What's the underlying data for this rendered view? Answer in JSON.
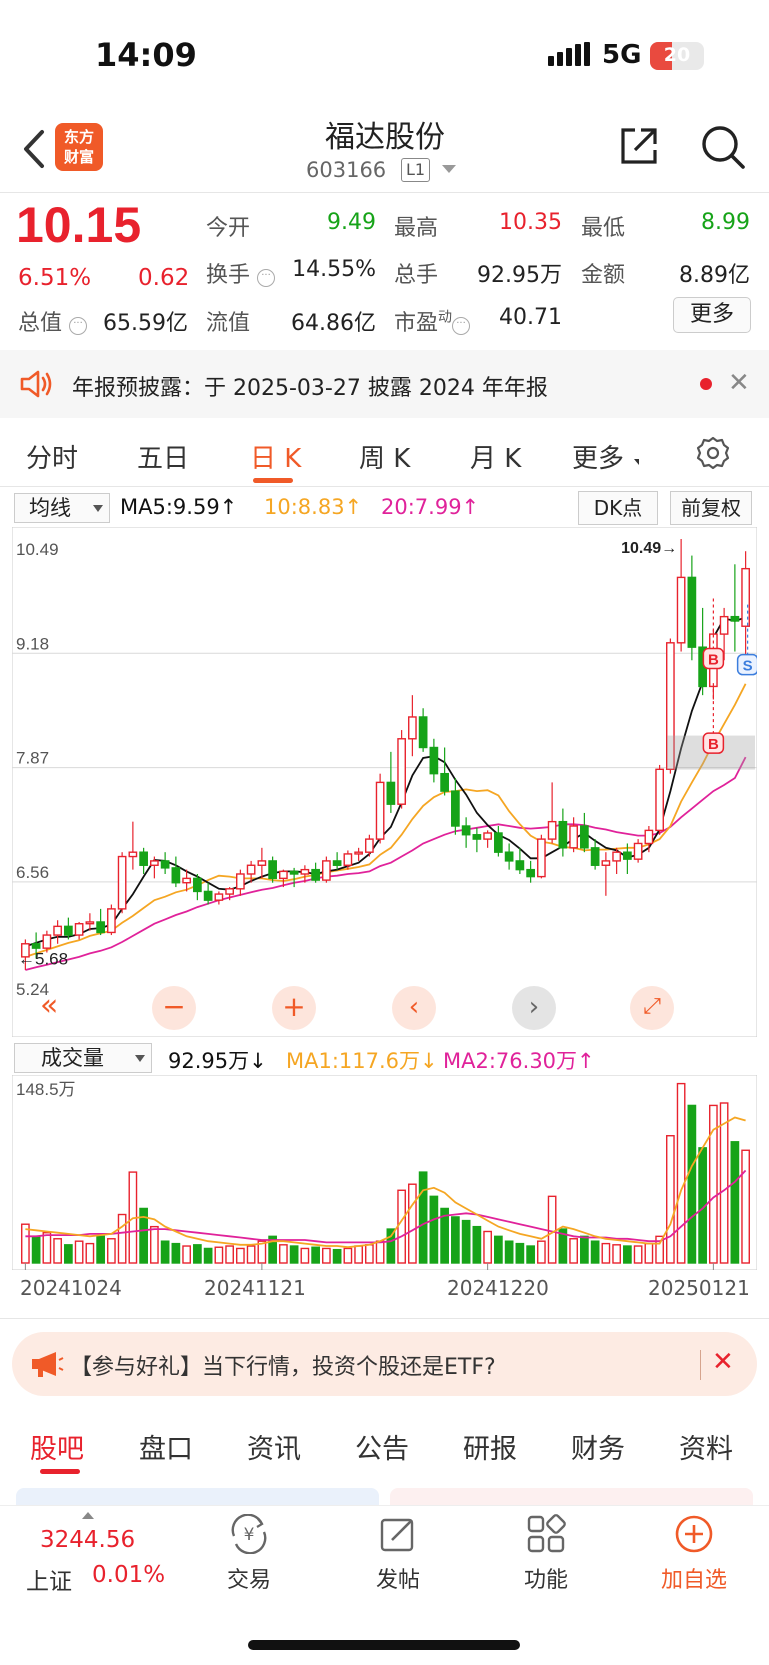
{
  "status": {
    "time": "14:09",
    "network": "5G",
    "battery": "20"
  },
  "header": {
    "name": "福达股份",
    "code": "603166",
    "level": "L1",
    "logo_line1": "东方",
    "logo_line2": "财富"
  },
  "quote": {
    "price": "10.15",
    "change_pct": "6.51%",
    "change": "0.62",
    "rows": {
      "open_label": "今开",
      "open": "9.49",
      "high_label": "最高",
      "high": "10.35",
      "low_label": "最低",
      "low": "8.99",
      "turnover_label": "换手",
      "turnover": "14.55%",
      "volume_label": "总手",
      "volume": "92.95万",
      "amount_label": "金额",
      "amount": "8.89亿",
      "mktcap_label": "总值",
      "mktcap": "65.59亿",
      "float_label": "流值",
      "float": "64.86亿",
      "pe_label": "市盈",
      "pe_sup": "动",
      "pe": "40.71"
    },
    "more": "更多"
  },
  "notice": {
    "text": "年报预披露：于 2025-03-27 披露 2024 年年报"
  },
  "chart_tabs": [
    "分时",
    "五日",
    "日 K",
    "周 K",
    "月 K",
    "更多"
  ],
  "indicators": {
    "ma_select": "均线",
    "ma5": "MA5:9.59↑",
    "ma10": "10:8.83↑",
    "ma20": "20:7.99↑",
    "dk": "DK点",
    "adjust": "前复权"
  },
  "colors": {
    "up": "#e8222d",
    "down": "#16a318",
    "ma5": "#111111",
    "ma10": "#f5a623",
    "ma20": "#e0229a",
    "accent": "#f05a28"
  },
  "chart_data": [
    {
      "type": "candlestick",
      "y_ticks": [
        "10.49",
        "9.18",
        "7.87",
        "6.56",
        "5.24"
      ],
      "ylim": [
        5.24,
        10.49
      ],
      "high_marker": "10.49→",
      "low_marker": "←5.68",
      "signals": [
        "B",
        "S",
        "B"
      ],
      "ohlc": [
        [
          5.7,
          5.9,
          5.55,
          5.85
        ],
        [
          5.85,
          5.98,
          5.68,
          5.8
        ],
        [
          5.8,
          6.0,
          5.75,
          5.95
        ],
        [
          5.95,
          6.12,
          5.85,
          6.05
        ],
        [
          6.05,
          6.15,
          5.9,
          5.95
        ],
        [
          5.95,
          6.1,
          5.9,
          6.08
        ],
        [
          6.08,
          6.2,
          6.0,
          6.1
        ],
        [
          6.1,
          6.25,
          5.95,
          5.98
        ],
        [
          5.98,
          6.3,
          5.95,
          6.25
        ],
        [
          6.25,
          6.9,
          6.2,
          6.85
        ],
        [
          6.85,
          7.25,
          6.7,
          6.9
        ],
        [
          6.9,
          6.95,
          6.65,
          6.75
        ],
        [
          6.75,
          6.85,
          6.6,
          6.8
        ],
        [
          6.8,
          6.9,
          6.65,
          6.72
        ],
        [
          6.72,
          6.85,
          6.5,
          6.55
        ],
        [
          6.55,
          6.7,
          6.45,
          6.6
        ],
        [
          6.6,
          6.65,
          6.35,
          6.45
        ],
        [
          6.45,
          6.55,
          6.3,
          6.35
        ],
        [
          6.35,
          6.45,
          6.3,
          6.42
        ],
        [
          6.42,
          6.5,
          6.35,
          6.48
        ],
        [
          6.48,
          6.7,
          6.4,
          6.65
        ],
        [
          6.65,
          6.8,
          6.55,
          6.75
        ],
        [
          6.75,
          6.95,
          6.6,
          6.8
        ],
        [
          6.8,
          6.85,
          6.55,
          6.6
        ],
        [
          6.6,
          6.7,
          6.5,
          6.68
        ],
        [
          6.68,
          6.72,
          6.5,
          6.65
        ],
        [
          6.65,
          6.75,
          6.55,
          6.7
        ],
        [
          6.7,
          6.78,
          6.55,
          6.58
        ],
        [
          6.58,
          6.85,
          6.55,
          6.8
        ],
        [
          6.8,
          6.9,
          6.7,
          6.75
        ],
        [
          6.75,
          6.92,
          6.7,
          6.88
        ],
        [
          6.88,
          6.95,
          6.8,
          6.9
        ],
        [
          6.9,
          7.1,
          6.85,
          7.05
        ],
        [
          7.05,
          7.8,
          7.0,
          7.7
        ],
        [
          7.7,
          8.05,
          7.35,
          7.45
        ],
        [
          7.45,
          8.3,
          7.4,
          8.2
        ],
        [
          8.2,
          8.7,
          8.0,
          8.45
        ],
        [
          8.45,
          8.55,
          8.05,
          8.1
        ],
        [
          8.1,
          8.2,
          7.7,
          7.8
        ],
        [
          7.8,
          8.1,
          7.55,
          7.6
        ],
        [
          7.6,
          7.75,
          7.1,
          7.2
        ],
        [
          7.2,
          7.3,
          6.95,
          7.1
        ],
        [
          7.1,
          7.18,
          6.9,
          7.05
        ],
        [
          7.05,
          7.15,
          6.95,
          7.12
        ],
        [
          7.12,
          7.2,
          6.85,
          6.9
        ],
        [
          6.9,
          7.0,
          6.7,
          6.8
        ],
        [
          6.8,
          6.95,
          6.65,
          6.7
        ],
        [
          6.7,
          6.8,
          6.55,
          6.62
        ],
        [
          6.62,
          7.1,
          6.6,
          7.05
        ],
        [
          7.05,
          7.7,
          7.0,
          7.25
        ],
        [
          7.25,
          7.4,
          6.85,
          6.95
        ],
        [
          6.95,
          7.3,
          6.9,
          7.2
        ],
        [
          7.2,
          7.35,
          6.9,
          6.95
        ],
        [
          6.95,
          7.05,
          6.7,
          6.75
        ],
        [
          6.75,
          6.9,
          6.4,
          6.8
        ],
        [
          6.8,
          6.95,
          6.65,
          6.9
        ],
        [
          6.9,
          7.0,
          6.65,
          6.82
        ],
        [
          6.82,
          7.05,
          6.78,
          7.0
        ],
        [
          7.0,
          7.2,
          6.9,
          7.15
        ],
        [
          7.15,
          7.9,
          7.1,
          7.85
        ],
        [
          7.85,
          9.35,
          7.8,
          9.3
        ],
        [
          9.3,
          10.49,
          9.2,
          10.05
        ],
        [
          10.05,
          10.3,
          9.1,
          9.25
        ],
        [
          9.25,
          9.7,
          8.7,
          8.8
        ],
        [
          8.8,
          9.45,
          8.65,
          9.4
        ],
        [
          9.4,
          9.7,
          9.1,
          9.6
        ],
        [
          9.6,
          10.2,
          9.2,
          9.55
        ],
        [
          9.49,
          10.35,
          8.99,
          10.15
        ]
      ],
      "ma5": [
        5.82,
        5.86,
        5.9,
        5.93,
        5.93,
        5.96,
        6.02,
        6.03,
        6.07,
        6.25,
        6.42,
        6.62,
        6.81,
        6.8,
        6.75,
        6.68,
        6.62,
        6.55,
        6.48,
        6.47,
        6.51,
        6.57,
        6.62,
        6.66,
        6.68,
        6.68,
        6.67,
        6.65,
        6.68,
        6.7,
        6.74,
        6.78,
        6.88,
        7.06,
        7.19,
        7.47,
        7.78,
        7.98,
        8.0,
        7.93,
        7.73,
        7.56,
        7.35,
        7.21,
        7.1,
        7.04,
        6.94,
        6.83,
        6.83,
        6.9,
        6.97,
        7.05,
        7.12,
        7.03,
        6.95,
        6.92,
        6.84,
        6.87,
        6.95,
        7.16,
        7.6,
        8.09,
        8.52,
        8.85,
        9.36,
        9.58,
        9.55,
        9.59
      ],
      "ma10": [
        5.7,
        5.74,
        5.78,
        5.82,
        5.86,
        5.89,
        5.94,
        5.97,
        6.0,
        6.09,
        6.17,
        6.26,
        6.35,
        6.39,
        6.44,
        6.47,
        6.52,
        6.58,
        6.63,
        6.62,
        6.6,
        6.6,
        6.6,
        6.58,
        6.57,
        6.59,
        6.62,
        6.64,
        6.67,
        6.69,
        6.71,
        6.73,
        6.76,
        6.87,
        6.95,
        7.1,
        7.28,
        7.43,
        7.53,
        7.59,
        7.6,
        7.62,
        7.6,
        7.61,
        7.55,
        7.37,
        7.22,
        7.09,
        7.02,
        7.0,
        6.96,
        6.95,
        6.92,
        6.93,
        6.93,
        6.94,
        6.95,
        6.95,
        6.99,
        7.05,
        7.2,
        7.48,
        7.7,
        7.91,
        8.15,
        8.37,
        8.59,
        8.83
      ],
      "ma20": [
        5.55,
        5.58,
        5.61,
        5.64,
        5.67,
        5.7,
        5.74,
        5.77,
        5.81,
        5.87,
        5.94,
        6.01,
        6.08,
        6.13,
        6.18,
        6.22,
        6.27,
        6.31,
        6.35,
        6.38,
        6.41,
        6.44,
        6.47,
        6.49,
        6.52,
        6.55,
        6.57,
        6.6,
        6.62,
        6.63,
        6.65,
        6.66,
        6.68,
        6.74,
        6.78,
        6.85,
        6.92,
        7.0,
        7.05,
        7.1,
        7.14,
        7.16,
        7.18,
        7.2,
        7.22,
        7.2,
        7.18,
        7.17,
        7.18,
        7.19,
        7.22,
        7.22,
        7.21,
        7.18,
        7.16,
        7.13,
        7.11,
        7.09,
        7.09,
        7.12,
        7.19,
        7.3,
        7.4,
        7.5,
        7.6,
        7.67,
        7.75,
        7.99
      ]
    },
    {
      "type": "bar",
      "title": "成交量",
      "ymax_label": "148.5万",
      "ymax": 148.5,
      "values": [
        32,
        22,
        25,
        20,
        15,
        18,
        16,
        22,
        20,
        40,
        75,
        45,
        30,
        18,
        16,
        14,
        15,
        12,
        13,
        14,
        12,
        14,
        18,
        22,
        15,
        14,
        12,
        13,
        12,
        11,
        12,
        14,
        15,
        18,
        28,
        60,
        65,
        75,
        55,
        45,
        38,
        35,
        30,
        26,
        22,
        18,
        16,
        14,
        18,
        55,
        28,
        20,
        22,
        18,
        16,
        15,
        14,
        14,
        16,
        22,
        105,
        148,
        130,
        95,
        130,
        132,
        100,
        93
      ],
      "ma1": [
        28,
        27,
        26,
        25,
        24,
        23,
        22,
        23,
        24,
        30,
        37,
        38,
        36,
        30,
        26,
        22,
        20,
        18,
        17,
        16,
        15,
        15,
        16,
        18,
        18,
        17,
        16,
        15,
        14,
        14,
        13,
        14,
        15,
        18,
        22,
        35,
        48,
        60,
        62,
        58,
        50,
        45,
        40,
        35,
        30,
        27,
        24,
        22,
        20,
        25,
        30,
        28,
        25,
        22,
        20,
        19,
        18,
        17,
        16,
        16,
        32,
        60,
        80,
        95,
        110,
        115,
        120,
        117.6
      ],
      "ma2": [
        22,
        22,
        23,
        23,
        23,
        23,
        24,
        24,
        24,
        25,
        26,
        27,
        28,
        28,
        27,
        26,
        25,
        24,
        23,
        22,
        21,
        20,
        19,
        19,
        19,
        19,
        19,
        18,
        17,
        17,
        17,
        17,
        17,
        17,
        18,
        22,
        27,
        32,
        36,
        39,
        40,
        41,
        40,
        38,
        36,
        34,
        32,
        30,
        28,
        26,
        24,
        22,
        21,
        21,
        21,
        20,
        20,
        19,
        18,
        18,
        22,
        30,
        38,
        45,
        54,
        60,
        67,
        76.3
      ]
    }
  ],
  "volume_indicators": {
    "select": "成交量",
    "current": "92.95万↓",
    "ma1": "MA1:117.6万↓",
    "ma2": "MA2:76.30万↑"
  },
  "dates": [
    "20241024",
    "20241121",
    "20241220",
    "20250121"
  ],
  "promo": {
    "text": "【参与好礼】当下行情，投资个股还是ETF?"
  },
  "bottom_tabs": [
    "股吧",
    "盘口",
    "资讯",
    "公告",
    "研报",
    "财务",
    "资料"
  ],
  "bottom_nav": {
    "index_price": "3244.56",
    "index_name": "上证",
    "index_pct": "0.01%",
    "items": [
      "交易",
      "发帖",
      "功能",
      "加自选"
    ]
  }
}
